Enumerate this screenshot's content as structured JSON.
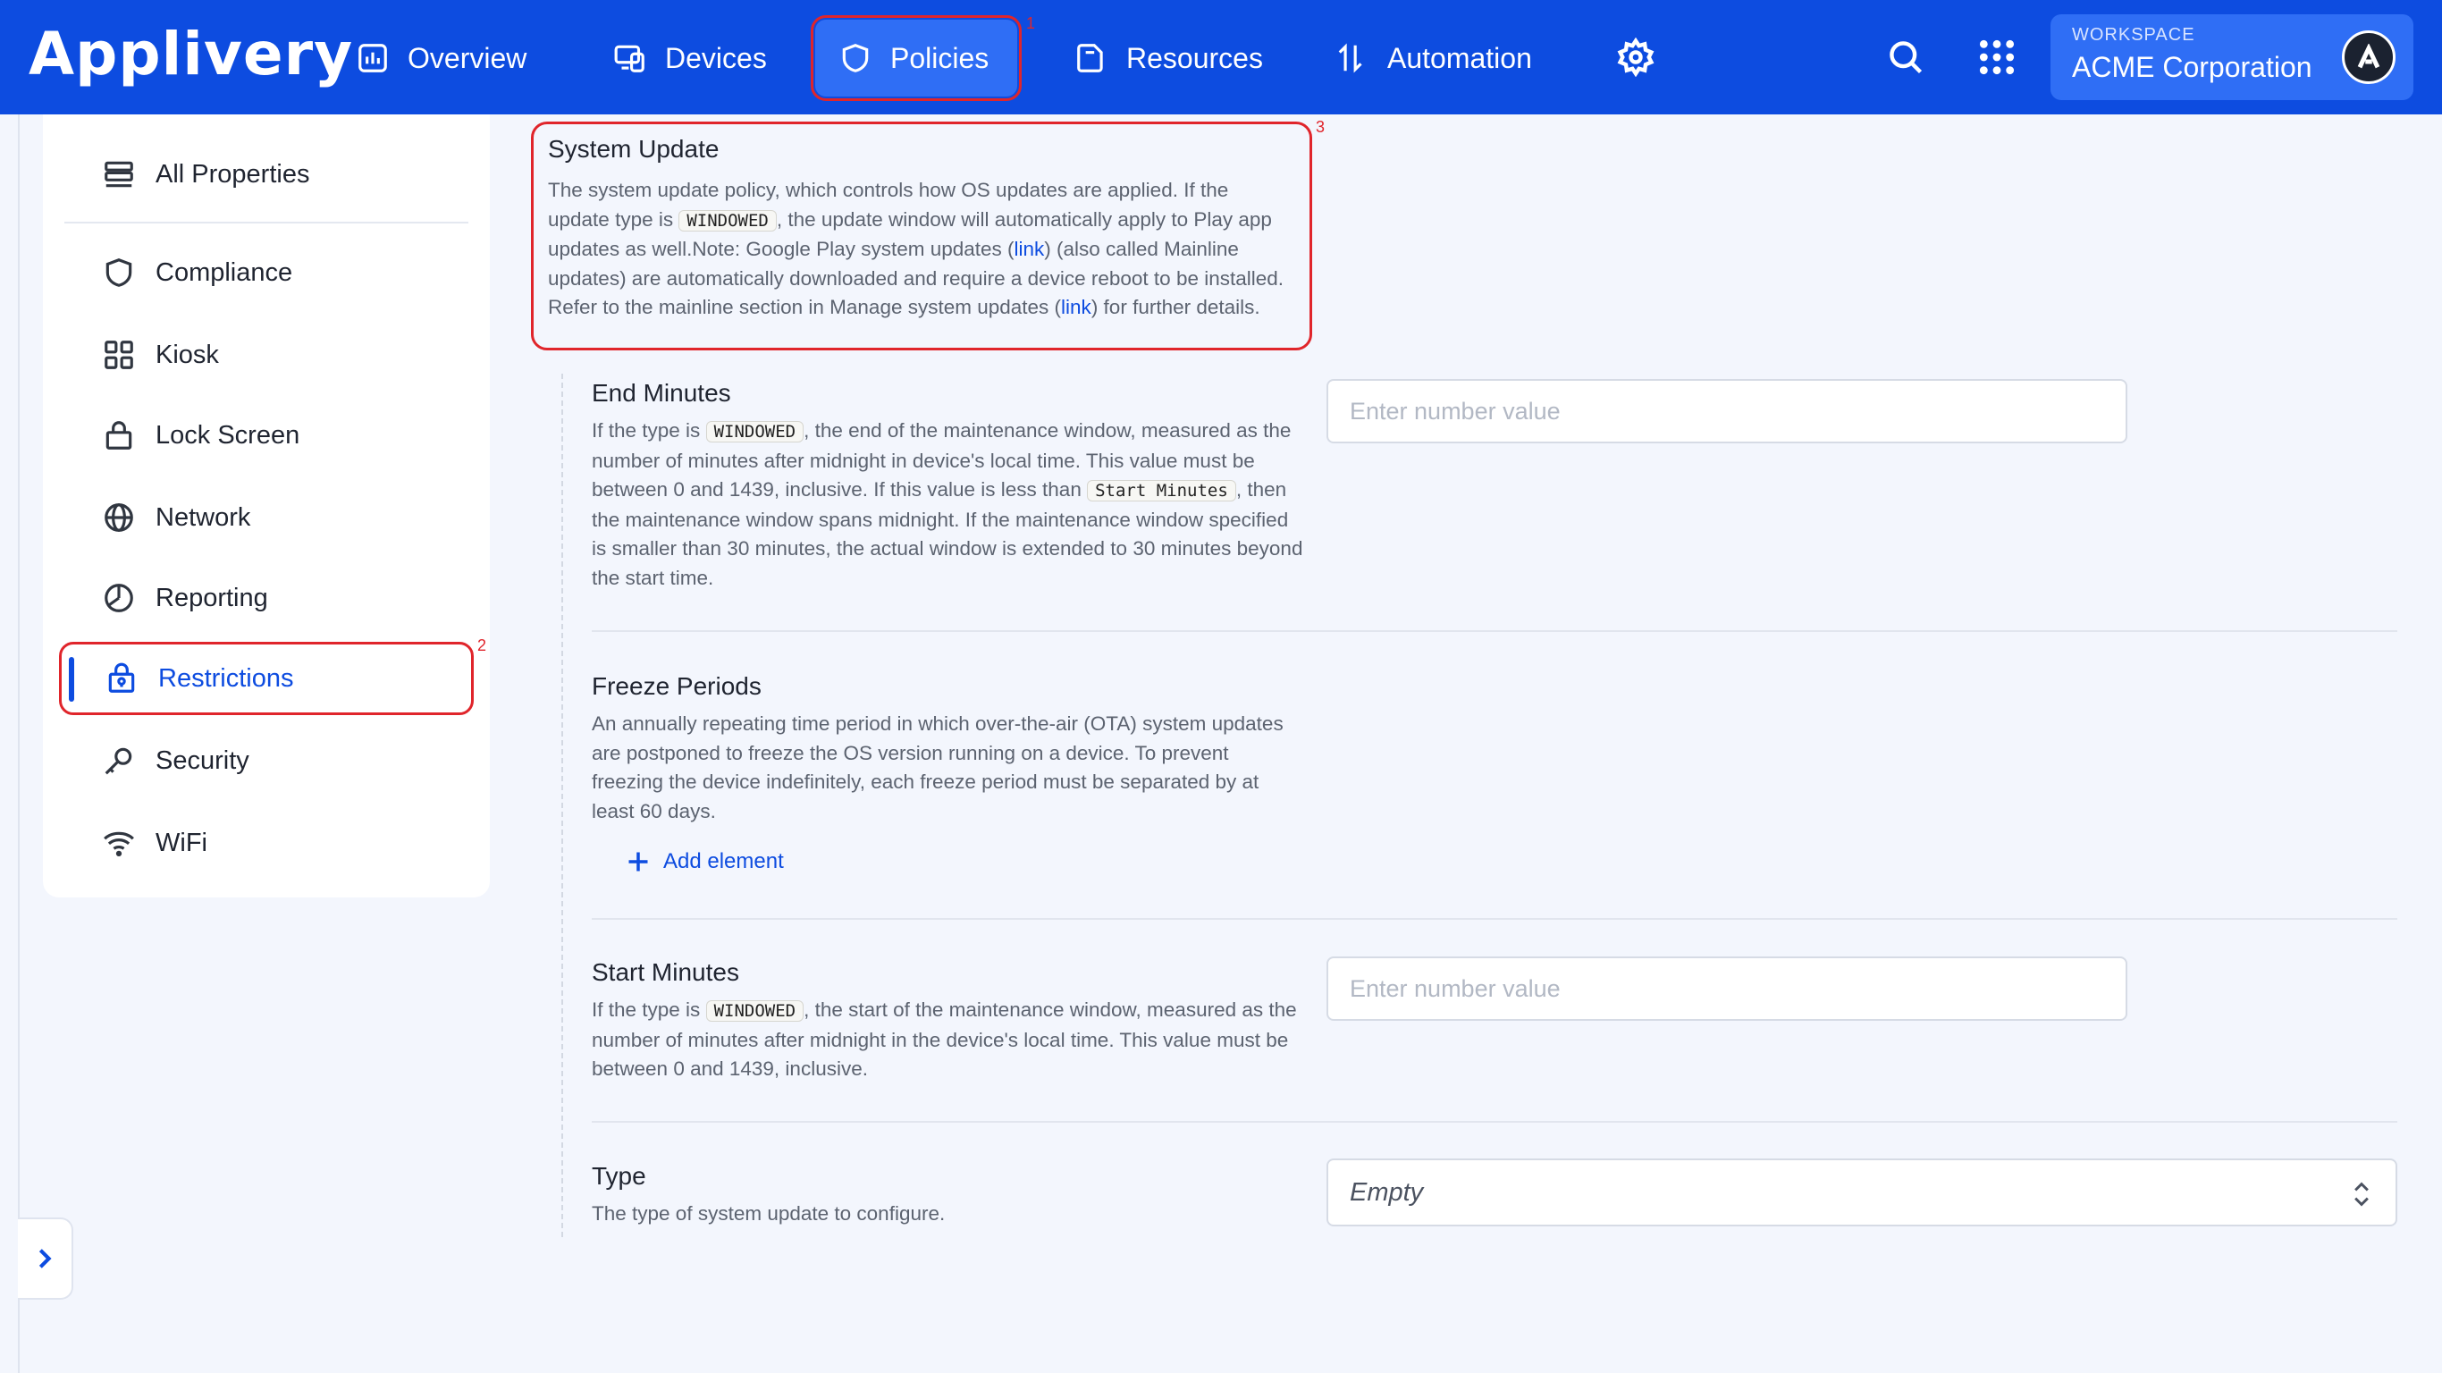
{
  "app": {
    "brand": "Applivery"
  },
  "nav": {
    "overview": "Overview",
    "devices": "Devices",
    "policies": "Policies",
    "policies_badge": "1",
    "resources": "Resources",
    "automation": "Automation"
  },
  "workspace": {
    "label": "WORKSPACE",
    "name": "ACME Corporation"
  },
  "sidebar": {
    "items": [
      {
        "label": "All Properties",
        "icon": "list-icon"
      },
      {
        "label": "Compliance",
        "icon": "shield-icon"
      },
      {
        "label": "Kiosk",
        "icon": "grid-icon"
      },
      {
        "label": "Lock Screen",
        "icon": "lock-icon"
      },
      {
        "label": "Network",
        "icon": "globe-icon"
      },
      {
        "label": "Reporting",
        "icon": "pie-chart-icon"
      },
      {
        "label": "Restrictions",
        "icon": "lock-badge-icon"
      },
      {
        "label": "Security",
        "icon": "key-icon"
      },
      {
        "label": "WiFi",
        "icon": "wifi-icon"
      }
    ],
    "active_badge": "2"
  },
  "system_update": {
    "badge": "3",
    "title": "System Update",
    "desc_1": "The system update policy, which controls how OS updates are applied. If the update type is ",
    "code": "WINDOWED",
    "desc_2": ", the update window will automatically apply to Play app updates as well.Note: Google Play system updates (",
    "link_1": "link",
    "desc_3": ") (also called Mainline updates) are automatically downloaded and require a device reboot to be installed. Refer to the mainline section in Manage system updates (",
    "link_2": "link",
    "desc_4": ") for further details."
  },
  "end_minutes": {
    "title": "End Minutes",
    "desc_1": "If the type is ",
    "code": "WINDOWED",
    "desc_2": ", the end of the maintenance window, measured as the number of minutes after midnight in device's local time. This value must be between 0 and 1439, inclusive. If this value is less than ",
    "code_2": "Start Minutes",
    "desc_3": ", then the maintenance window spans midnight. If the maintenance window specified is smaller than 30 minutes, the actual window is extended to 30 minutes beyond the start time.",
    "placeholder": "Enter number value"
  },
  "freeze_periods": {
    "title": "Freeze Periods",
    "desc": "An annually repeating time period in which over-the-air (OTA) system updates are postponed to freeze the OS version running on a device. To prevent freezing the device indefinitely, each freeze period must be separated by at least 60 days.",
    "add_label": "Add element"
  },
  "start_minutes": {
    "title": "Start Minutes",
    "desc_1": "If the type is ",
    "code": "WINDOWED",
    "desc_2": ", the start of the maintenance window, measured as the number of minutes after midnight in the device's local time. This value must be between 0 and 1439, inclusive.",
    "placeholder": "Enter number value"
  },
  "type": {
    "title": "Type",
    "desc": "The type of system update to configure.",
    "value": "Empty"
  }
}
